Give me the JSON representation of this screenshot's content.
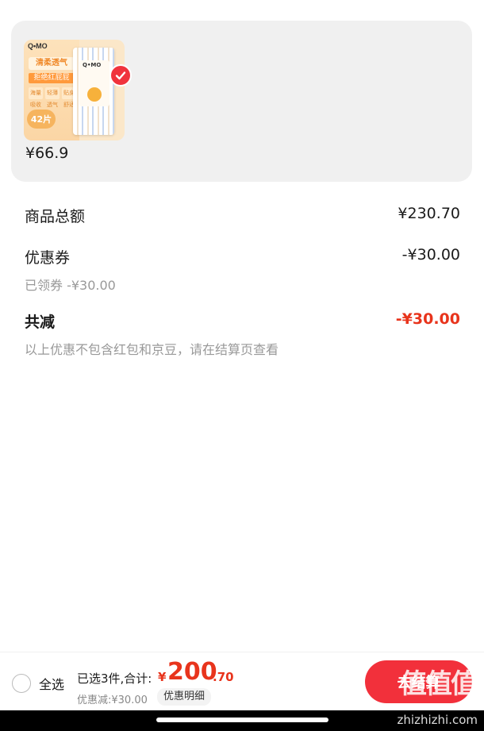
{
  "product": {
    "image_name": "qmo-diaper-pack",
    "brand": "Q•MO",
    "tag_main": "清柔透气",
    "tag_sub": "拒绝红屁屁",
    "features": [
      "海量吸收",
      "轻薄透气",
      "贴身舒适"
    ],
    "count_label": "42片",
    "price": "¥66.9"
  },
  "summary": {
    "goods_total_label": "商品总额",
    "goods_total_value": "¥230.70",
    "coupon_label": "优惠券",
    "coupon_value": "-¥30.00",
    "coupon_claimed": "已领券 -¥30.00",
    "total_reduce_label": "共减",
    "total_reduce_value": "-¥30.00",
    "note": "以上优惠不包含红包和京豆，请在结算页查看"
  },
  "bottom_bar": {
    "select_all_label": "全选",
    "selected_info": "已选3件,合计:",
    "total_currency": "¥",
    "total_integer": "200",
    "total_decimal": ".70",
    "discount_line": "优惠减:¥30.00",
    "detail_button": "优惠明细",
    "settle_button": "去结算"
  },
  "watermark": {
    "logo_text": "值值值",
    "url": "zhizhizhi.com"
  },
  "colors": {
    "accent_red": "#e8341c",
    "button_red": "#f2303b",
    "card_bg": "#f0f0f0"
  }
}
